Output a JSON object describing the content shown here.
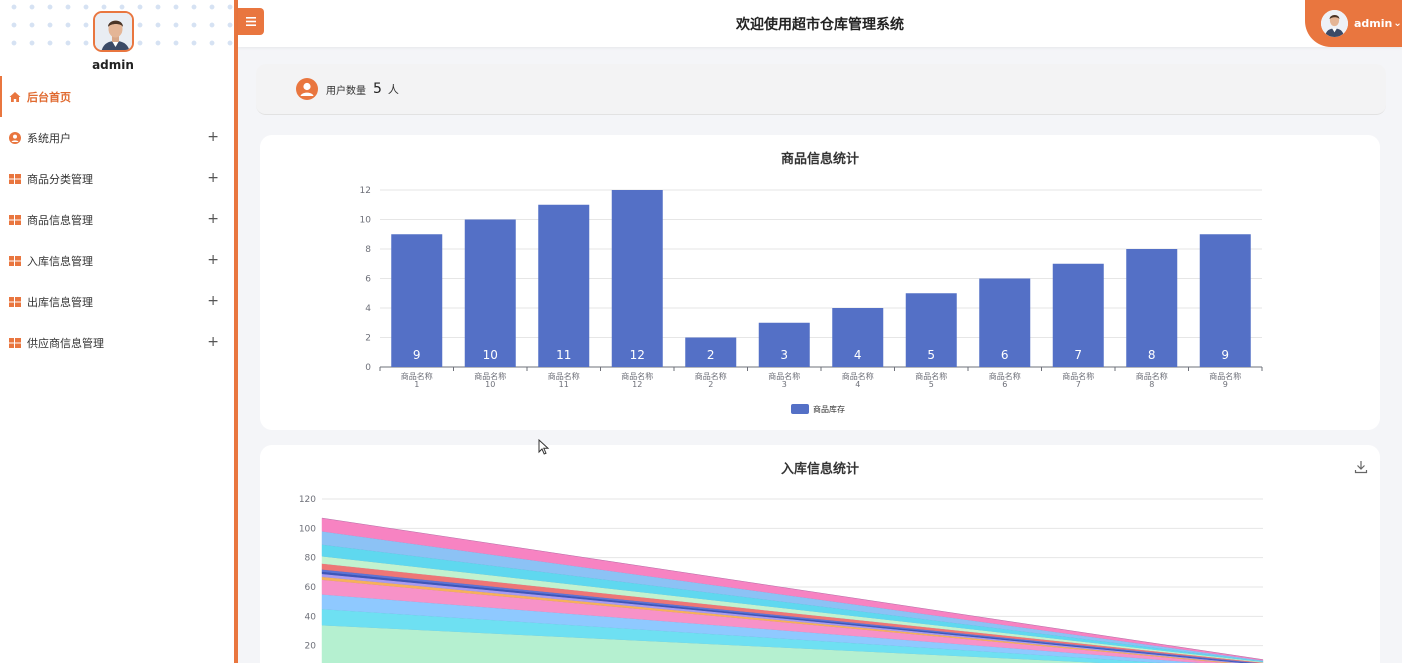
{
  "app": {
    "title": "欢迎使用超市仓库管理系统",
    "toggle_icon": "menu-icon",
    "user_menu": {
      "name": "admin",
      "arrow": "⌄"
    }
  },
  "sidebar": {
    "profile_name": "admin",
    "items": [
      {
        "label": "后台首页",
        "icon": "home-icon",
        "active": true,
        "expand": ""
      },
      {
        "label": "系统用户",
        "icon": "user-icon",
        "active": false,
        "expand": "+"
      },
      {
        "label": "商品分类管理",
        "icon": "grid-icon",
        "active": false,
        "expand": "+"
      },
      {
        "label": "商品信息管理",
        "icon": "grid-icon",
        "active": false,
        "expand": "+"
      },
      {
        "label": "入库信息管理",
        "icon": "grid-icon",
        "active": false,
        "expand": "+"
      },
      {
        "label": "出库信息管理",
        "icon": "grid-icon",
        "active": false,
        "expand": "+"
      },
      {
        "label": "供应商信息管理",
        "icon": "grid-icon",
        "active": false,
        "expand": "+"
      }
    ]
  },
  "user_count": {
    "label": "用户数量",
    "value": "5",
    "unit": "人"
  },
  "colors": {
    "accent": "#e9763f",
    "bar": "#5470c6"
  },
  "chart_data": [
    {
      "type": "bar",
      "title": "商品信息统计",
      "categories": [
        "商品名称\n1",
        "商品名称\n10",
        "商品名称\n11",
        "商品名称\n12",
        "商品名称\n2",
        "商品名称\n3",
        "商品名称\n4",
        "商品名称\n5",
        "商品名称\n6",
        "商品名称\n7",
        "商品名称\n8",
        "商品名称\n9"
      ],
      "series": [
        {
          "name": "商品库存",
          "values": [
            9,
            10,
            11,
            12,
            2,
            3,
            4,
            5,
            6,
            7,
            8,
            9
          ]
        }
      ],
      "ylim": [
        0,
        12
      ],
      "yticks": [
        0,
        2,
        4,
        6,
        8,
        10,
        12
      ],
      "grid": true,
      "legend": "bottom",
      "data_labels": true
    },
    {
      "type": "area",
      "title": "入库信息统计",
      "stacked": true,
      "ylim": [
        0,
        120
      ],
      "yticks": [
        20,
        40,
        60,
        80,
        100,
        120
      ],
      "grid": true,
      "x": [
        "",
        ""
      ],
      "series": [
        {
          "values": [
            34,
            3
          ],
          "color": "#b5f0d0"
        },
        {
          "values": [
            11,
            1
          ],
          "color": "#6ee0f2"
        },
        {
          "values": [
            10,
            1
          ],
          "color": "#8fc9ff"
        },
        {
          "values": [
            10,
            1
          ],
          "color": "#f792c8"
        },
        {
          "values": [
            2,
            0.5
          ],
          "color": "#f7b15a"
        },
        {
          "values": [
            2,
            0.5
          ],
          "color": "#a99af0"
        },
        {
          "values": [
            1.5,
            0.5
          ],
          "color": "#3d55b8"
        },
        {
          "values": [
            1.5,
            0.5
          ],
          "color": "#5c74d6"
        },
        {
          "values": [
            4,
            0.5
          ],
          "color": "#ee7676"
        },
        {
          "values": [
            5,
            0.5
          ],
          "color": "#c2f2cf"
        },
        {
          "values": [
            8,
            0.5
          ],
          "color": "#5fd8ef"
        },
        {
          "values": [
            9,
            0.5
          ],
          "color": "#8cc2f5"
        },
        {
          "values": [
            9,
            0.5
          ],
          "color": "#f783c2"
        }
      ]
    }
  ]
}
